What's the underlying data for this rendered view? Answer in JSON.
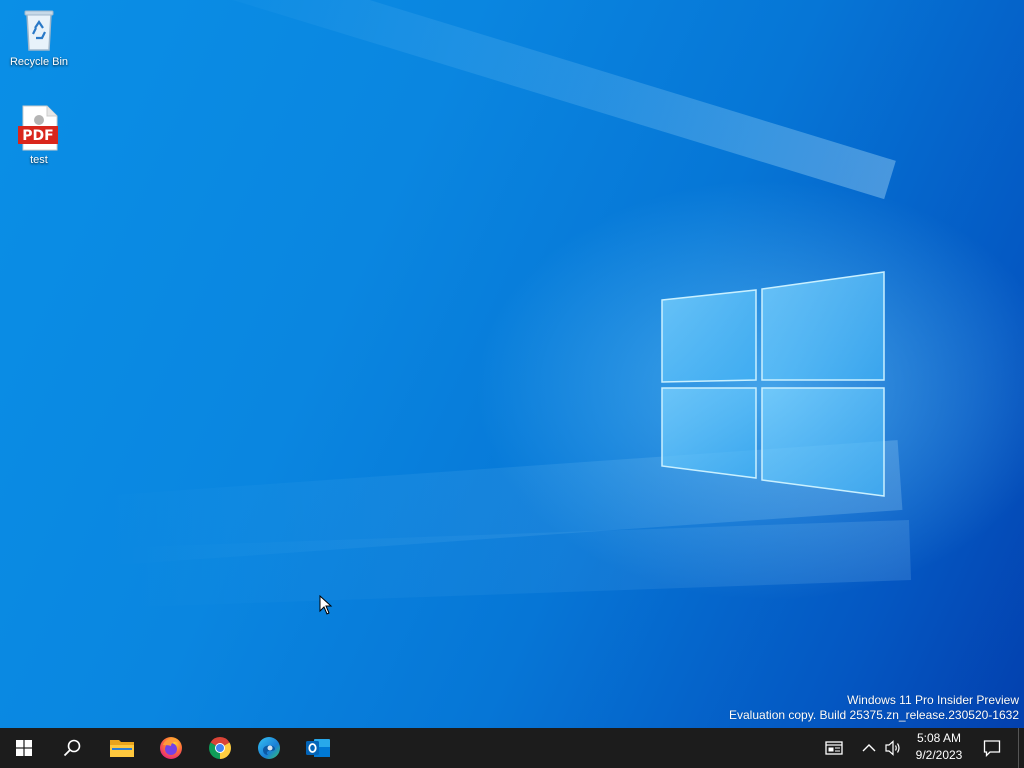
{
  "desktop": {
    "icons": [
      {
        "label": "Recycle Bin",
        "icon": "recycle-bin-icon"
      },
      {
        "label": "test",
        "icon": "pdf-file-icon",
        "badge": "PDF"
      }
    ],
    "watermark": {
      "line1": "Windows 11 Pro Insider Preview",
      "line2": "Evaluation copy. Build 25375.zn_release.230520-1632"
    }
  },
  "taskbar": {
    "start": {
      "icon": "windows-start-icon"
    },
    "search": {
      "icon": "search-icon"
    },
    "pinned_apps": [
      {
        "name": "File Explorer",
        "icon": "file-explorer-icon"
      },
      {
        "name": "Firefox",
        "icon": "firefox-icon"
      },
      {
        "name": "Google Chrome",
        "icon": "chrome-icon"
      },
      {
        "name": "Microsoft Edge",
        "icon": "edge-icon"
      },
      {
        "name": "Outlook",
        "icon": "outlook-icon"
      }
    ],
    "tray": {
      "news_icon": "news-widget-icon",
      "chevron_icon": "chevron-up-icon",
      "volume_icon": "volume-icon",
      "time": "5:08 AM",
      "date": "9/2/2023",
      "notification_icon": "notification-icon"
    }
  },
  "colors": {
    "taskbar_bg": "#1c1c1c",
    "wallpaper_blue": "#0a86e0",
    "pdf_red": "#d9261c"
  }
}
